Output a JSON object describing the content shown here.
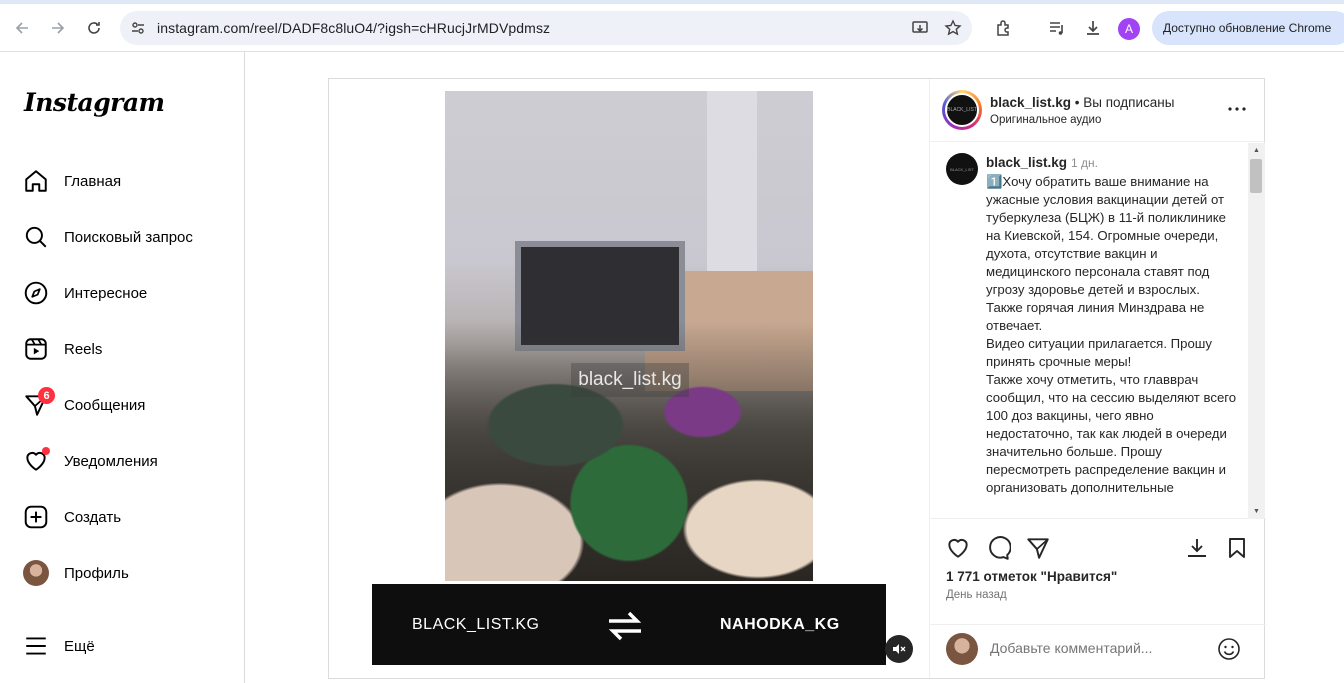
{
  "browser": {
    "url": "instagram.com/reel/DADF8c8luO4/?igsh=cHRucjJrMDVpdmsz",
    "profile_initial": "A",
    "profile_color": "#a142f4",
    "update_label": "Доступно обновление Chrome",
    "icons": [
      "back-icon",
      "forward-icon",
      "reload-icon",
      "site-info-icon",
      "install-icon",
      "star-icon",
      "extensions-icon",
      "media-icon",
      "download-icon"
    ]
  },
  "sidebar": {
    "logo": "Instagram",
    "items": [
      {
        "label": "Главная",
        "icon": "home-icon"
      },
      {
        "label": "Поисковый запрос",
        "icon": "search-icon"
      },
      {
        "label": "Интересное",
        "icon": "compass-icon"
      },
      {
        "label": "Reels",
        "icon": "reels-icon"
      },
      {
        "label": "Сообщения",
        "icon": "messenger-icon",
        "badge": "6"
      },
      {
        "label": "Уведомления",
        "icon": "heart-icon"
      },
      {
        "label": "Создать",
        "icon": "plus-square-icon"
      },
      {
        "label": "Профиль",
        "icon": "avatar"
      }
    ],
    "more_label": "Ещё"
  },
  "post": {
    "video": {
      "watermark": "black_list.kg",
      "banner_left": "BLACK_LIST.KG",
      "banner_right": "NAHODKA_KG"
    },
    "header": {
      "username": "black_list.kg",
      "separator": " • ",
      "follow_status": "Вы подписаны",
      "audio": "Оригинальное аудио"
    },
    "caption": {
      "username": "black_list.kg",
      "time": "1 дн.",
      "text": "1️⃣Хочу обратить ваше внимание на ужасные условия вакцинации детей от туберкулеза (БЦЖ) в 11-й поликлинике на Киевской, 154. Огромные очереди, духота, отсутствие вакцин и медицинского персонала ставят под угрозу здоровье детей и взрослых. Также горячая линия Минздрава не отвечает.\nВидео ситуации прилагается. Прошу принять срочные меры!\nТакже хочу отметить, что главврач сообщил, что на сессию выделяют всего 100 доз вакцины, чего явно недостаточно, так как людей в очереди значительно больше. Прошу пересмотреть распределение вакцин и организовать дополнительные"
    },
    "likes": "1 771 отметок \"Нравится\"",
    "posted_ago": "День назад",
    "comment_placeholder": "Добавьте комментарий..."
  },
  "colors": {
    "badge": "#ff3040",
    "update_pill": "#d7e4fb",
    "omnibox": "#eef1f8"
  }
}
